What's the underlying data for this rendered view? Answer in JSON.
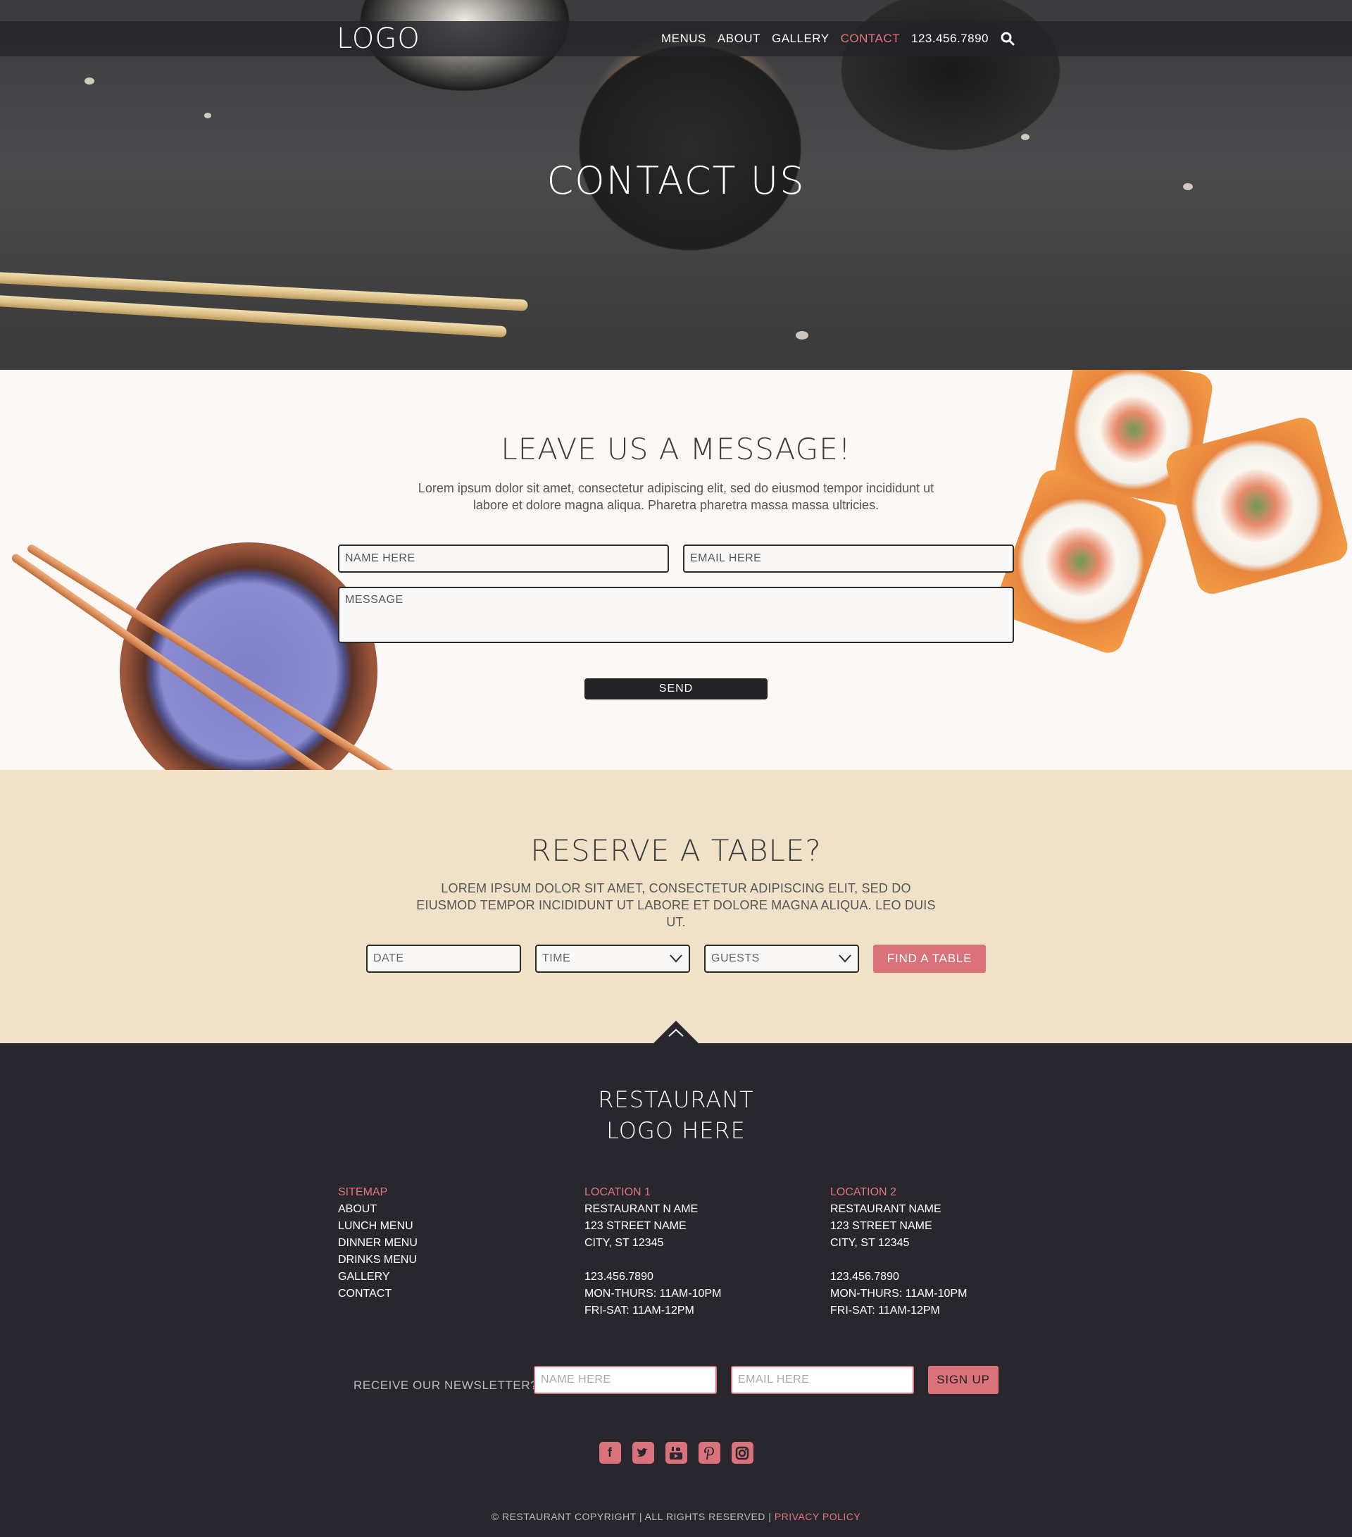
{
  "nav": {
    "logo": "LOGO",
    "links": [
      "MENUS",
      "ABOUT",
      "GALLERY",
      "CONTACT"
    ],
    "phone": "123.456.7890",
    "active": "CONTACT"
  },
  "hero": {
    "title": "CONTACT US"
  },
  "message": {
    "title": "LEAVE US A MESSAGE!",
    "description": "Lorem ipsum dolor sit amet, consectetur adipiscing elit, sed do eiusmod tempor incididunt ut labore et dolore magna aliqua. Pharetra pharetra massa massa ultricies.",
    "name_placeholder": "NAME HERE",
    "email_placeholder": "EMAIL HERE",
    "message_placeholder": "MESSAGE",
    "send_label": "SEND"
  },
  "reserve": {
    "title": "RESERVE A TABLE?",
    "description": "LOREM IPSUM DOLOR SIT AMET, CONSECTETUR ADIPISCING ELIT, SED DO EIUSMOD TEMPOR INCIDIDUNT UT LABORE ET DOLORE MAGNA ALIQUA. LEO DUIS UT.",
    "date_placeholder": "DATE",
    "time_placeholder": "TIME",
    "guests_placeholder": "GUESTS",
    "find_label": "FIND A TABLE"
  },
  "footer": {
    "logo_line1": "RESTAURANT",
    "logo_line2": "LOGO HERE",
    "sitemap": {
      "heading": "SITEMAP",
      "items": [
        "ABOUT",
        "LUNCH MENU",
        "DINNER MENU",
        "DRINKS MENU",
        "GALLERY",
        "CONTACT"
      ]
    },
    "location1": {
      "heading": "LOCATION 1",
      "name": "RESTAURANT N AME",
      "street": "123 STREET NAME",
      "city": "CITY, ST 12345",
      "phone": "123.456.7890",
      "hours1": "MON-THURS: 11AM-10PM",
      "hours2": "FRI-SAT: 11AM-12PM"
    },
    "location2": {
      "heading": "LOCATION 2",
      "name": "RESTAURANT NAME",
      "street": "123 STREET NAME",
      "city": "CITY, ST 12345",
      "phone": "123.456.7890",
      "hours1": "MON-THURS: 11AM-10PM",
      "hours2": "FRI-SAT: 11AM-12PM"
    },
    "newsletter": {
      "label": "RECEIVE OUR NEWSLETTER?",
      "name_placeholder": "NAME HERE",
      "email_placeholder": "EMAIL HERE",
      "signup_label": "SIGN UP"
    },
    "socials": [
      "facebook-icon",
      "twitter-icon",
      "youtube-icon",
      "pinterest-icon",
      "instagram-icon"
    ],
    "copyright": "© RESTAURANT COPYRIGHT | ALL RIGHTS RESERVED |",
    "privacy": "PRIVACY POLICY"
  },
  "colors": {
    "accent": "#d9727a",
    "dark": "#27272d",
    "cream": "#efe2c8",
    "light": "#fbf8f5"
  }
}
